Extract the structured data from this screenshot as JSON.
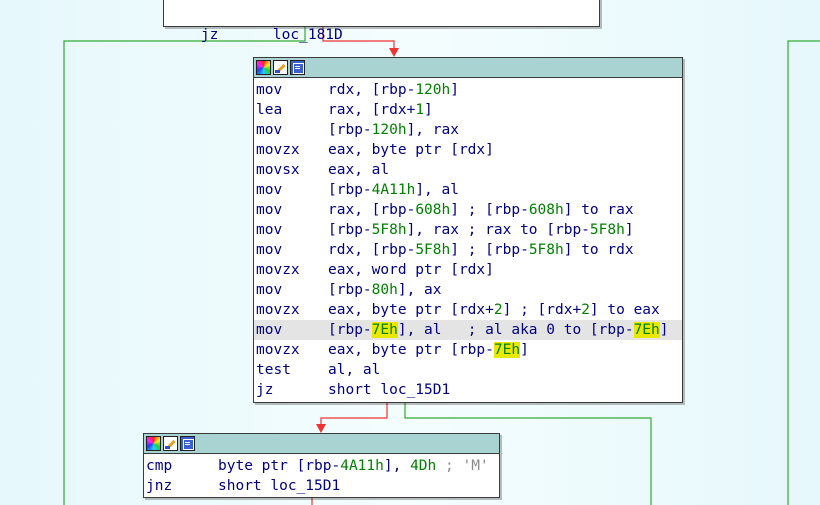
{
  "colors": {
    "background": "#e6f8fc",
    "block_header": "#a9d3d3",
    "mnemonic_text": "#000080",
    "number_text": "#008000",
    "comment_text": "#8a8a8a",
    "highlight": "#e8e800",
    "edge_true": "#33aa33",
    "edge_false": "#ee3333"
  },
  "top_block": {
    "lines": [
      {
        "mnemonic": "jz",
        "operand": "loc_181D"
      }
    ]
  },
  "main_block": {
    "header_icons": [
      "color-icon",
      "edit-icon",
      "graph-icon"
    ],
    "lines": [
      {
        "mnemonic": "mov",
        "a": "rdx, [rbp-",
        "n1": "120h",
        "b": "]"
      },
      {
        "mnemonic": "lea",
        "a": "rax, [rdx+",
        "n1": "1",
        "b": "]"
      },
      {
        "mnemonic": "mov",
        "a": "[rbp-",
        "n1": "120h",
        "b": "], rax"
      },
      {
        "mnemonic": "movzx",
        "a": "eax, byte ptr [rdx]"
      },
      {
        "mnemonic": "movsx",
        "a": "eax, al"
      },
      {
        "mnemonic": "mov",
        "a": "[rbp-",
        "n1": "4A11h",
        "b": "], al"
      },
      {
        "mnemonic": "mov",
        "a": "rax, [rbp-",
        "n1": "608h",
        "b": "] ; [rbp-",
        "n2": "608h",
        "c": "] to rax"
      },
      {
        "mnemonic": "mov",
        "a": "[rbp-",
        "n1": "5F8h",
        "b": "], rax ; rax to [rbp-",
        "n2": "5F8h",
        "c": "]"
      },
      {
        "mnemonic": "mov",
        "a": "rdx, [rbp-",
        "n1": "5F8h",
        "b": "] ; [rbp-",
        "n2": "5F8h",
        "c": "] to rdx"
      },
      {
        "mnemonic": "movzx",
        "a": "eax, word ptr [rdx]"
      },
      {
        "mnemonic": "mov",
        "a": "[rbp-",
        "n1": "80h",
        "b": "], ax"
      },
      {
        "mnemonic": "movzx",
        "a": "eax, byte ptr [rdx+",
        "n1": "2",
        "b": "] ; [rdx+",
        "n2": "2",
        "c": "] to eax"
      },
      {
        "mnemonic": "mov",
        "a": "[rbp-",
        "n1": "7Eh",
        "b": "], al   ; al aka 0 to [rbp-",
        "n2": "7Eh",
        "c": "]"
      },
      {
        "mnemonic": "movzx",
        "a": "eax, byte ptr [rbp-",
        "n1": "7Eh",
        "b": "]"
      },
      {
        "mnemonic": "test",
        "a": "al, al"
      },
      {
        "mnemonic": "jz",
        "a": "short loc_15D1"
      }
    ]
  },
  "bottom_block": {
    "header_icons": [
      "color-icon",
      "edit-icon",
      "graph-icon"
    ],
    "lines": [
      {
        "mnemonic": "cmp",
        "a": "byte ptr [rbp-",
        "n1": "4A11h",
        "b": "], ",
        "n2": "4Dh",
        "c": " ; 'M'"
      },
      {
        "mnemonic": "jnz",
        "a": "short loc_15D1"
      }
    ]
  }
}
